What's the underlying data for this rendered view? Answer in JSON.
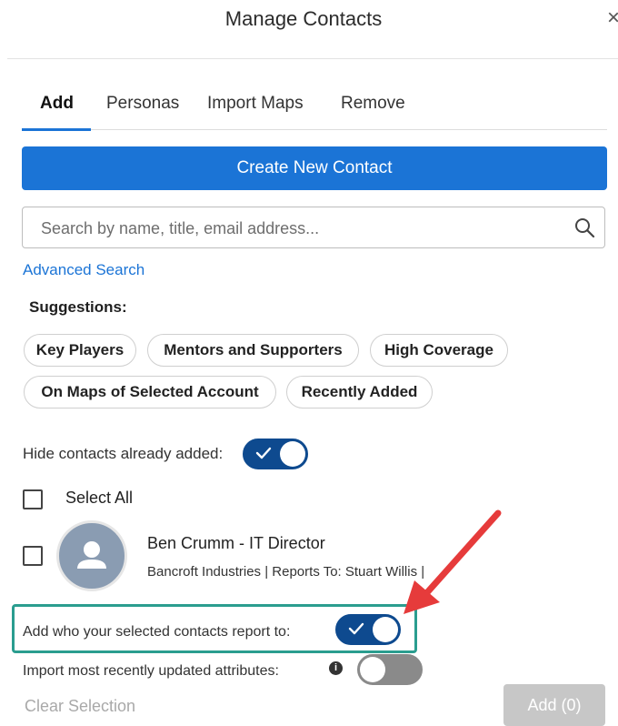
{
  "dialog": {
    "title": "Manage Contacts",
    "close_glyph": "×"
  },
  "tabs": [
    {
      "label": "Add",
      "active": true
    },
    {
      "label": "Personas",
      "active": false
    },
    {
      "label": "Import Maps",
      "active": false
    },
    {
      "label": "Remove",
      "active": false
    }
  ],
  "create_button": {
    "label": "Create New Contact"
  },
  "search": {
    "placeholder": "Search by name, title, email address...",
    "value": "",
    "icon": "search-icon"
  },
  "advanced_search": {
    "label": "Advanced Search"
  },
  "suggestions": {
    "label": "Suggestions:",
    "pills": [
      "Key Players",
      "Mentors and Supporters",
      "High Coverage",
      "On Maps of Selected Account",
      "Recently Added"
    ]
  },
  "hide_added": {
    "label": "Hide contacts already added:",
    "on": true
  },
  "select_all": {
    "label": "Select All",
    "checked": false
  },
  "contact": {
    "name": "Ben Crumm  - IT Director",
    "details": "Bancroft Industries | Reports To: Stuart Willis |",
    "checked": false,
    "avatar_icon": "person-icon"
  },
  "report_to": {
    "label": "Add who your selected contacts report to:",
    "on": true
  },
  "import_attrs": {
    "label": "Import most recently updated attributes:",
    "on": false,
    "info_glyph": "i"
  },
  "footer": {
    "clear_label": "Clear Selection",
    "add_label": "Add (0)"
  },
  "colors": {
    "primary": "#1b74d6",
    "toggle_on": "#0e4a8f",
    "highlight": "#2a9d8f",
    "arrow": "#e63b3b"
  }
}
